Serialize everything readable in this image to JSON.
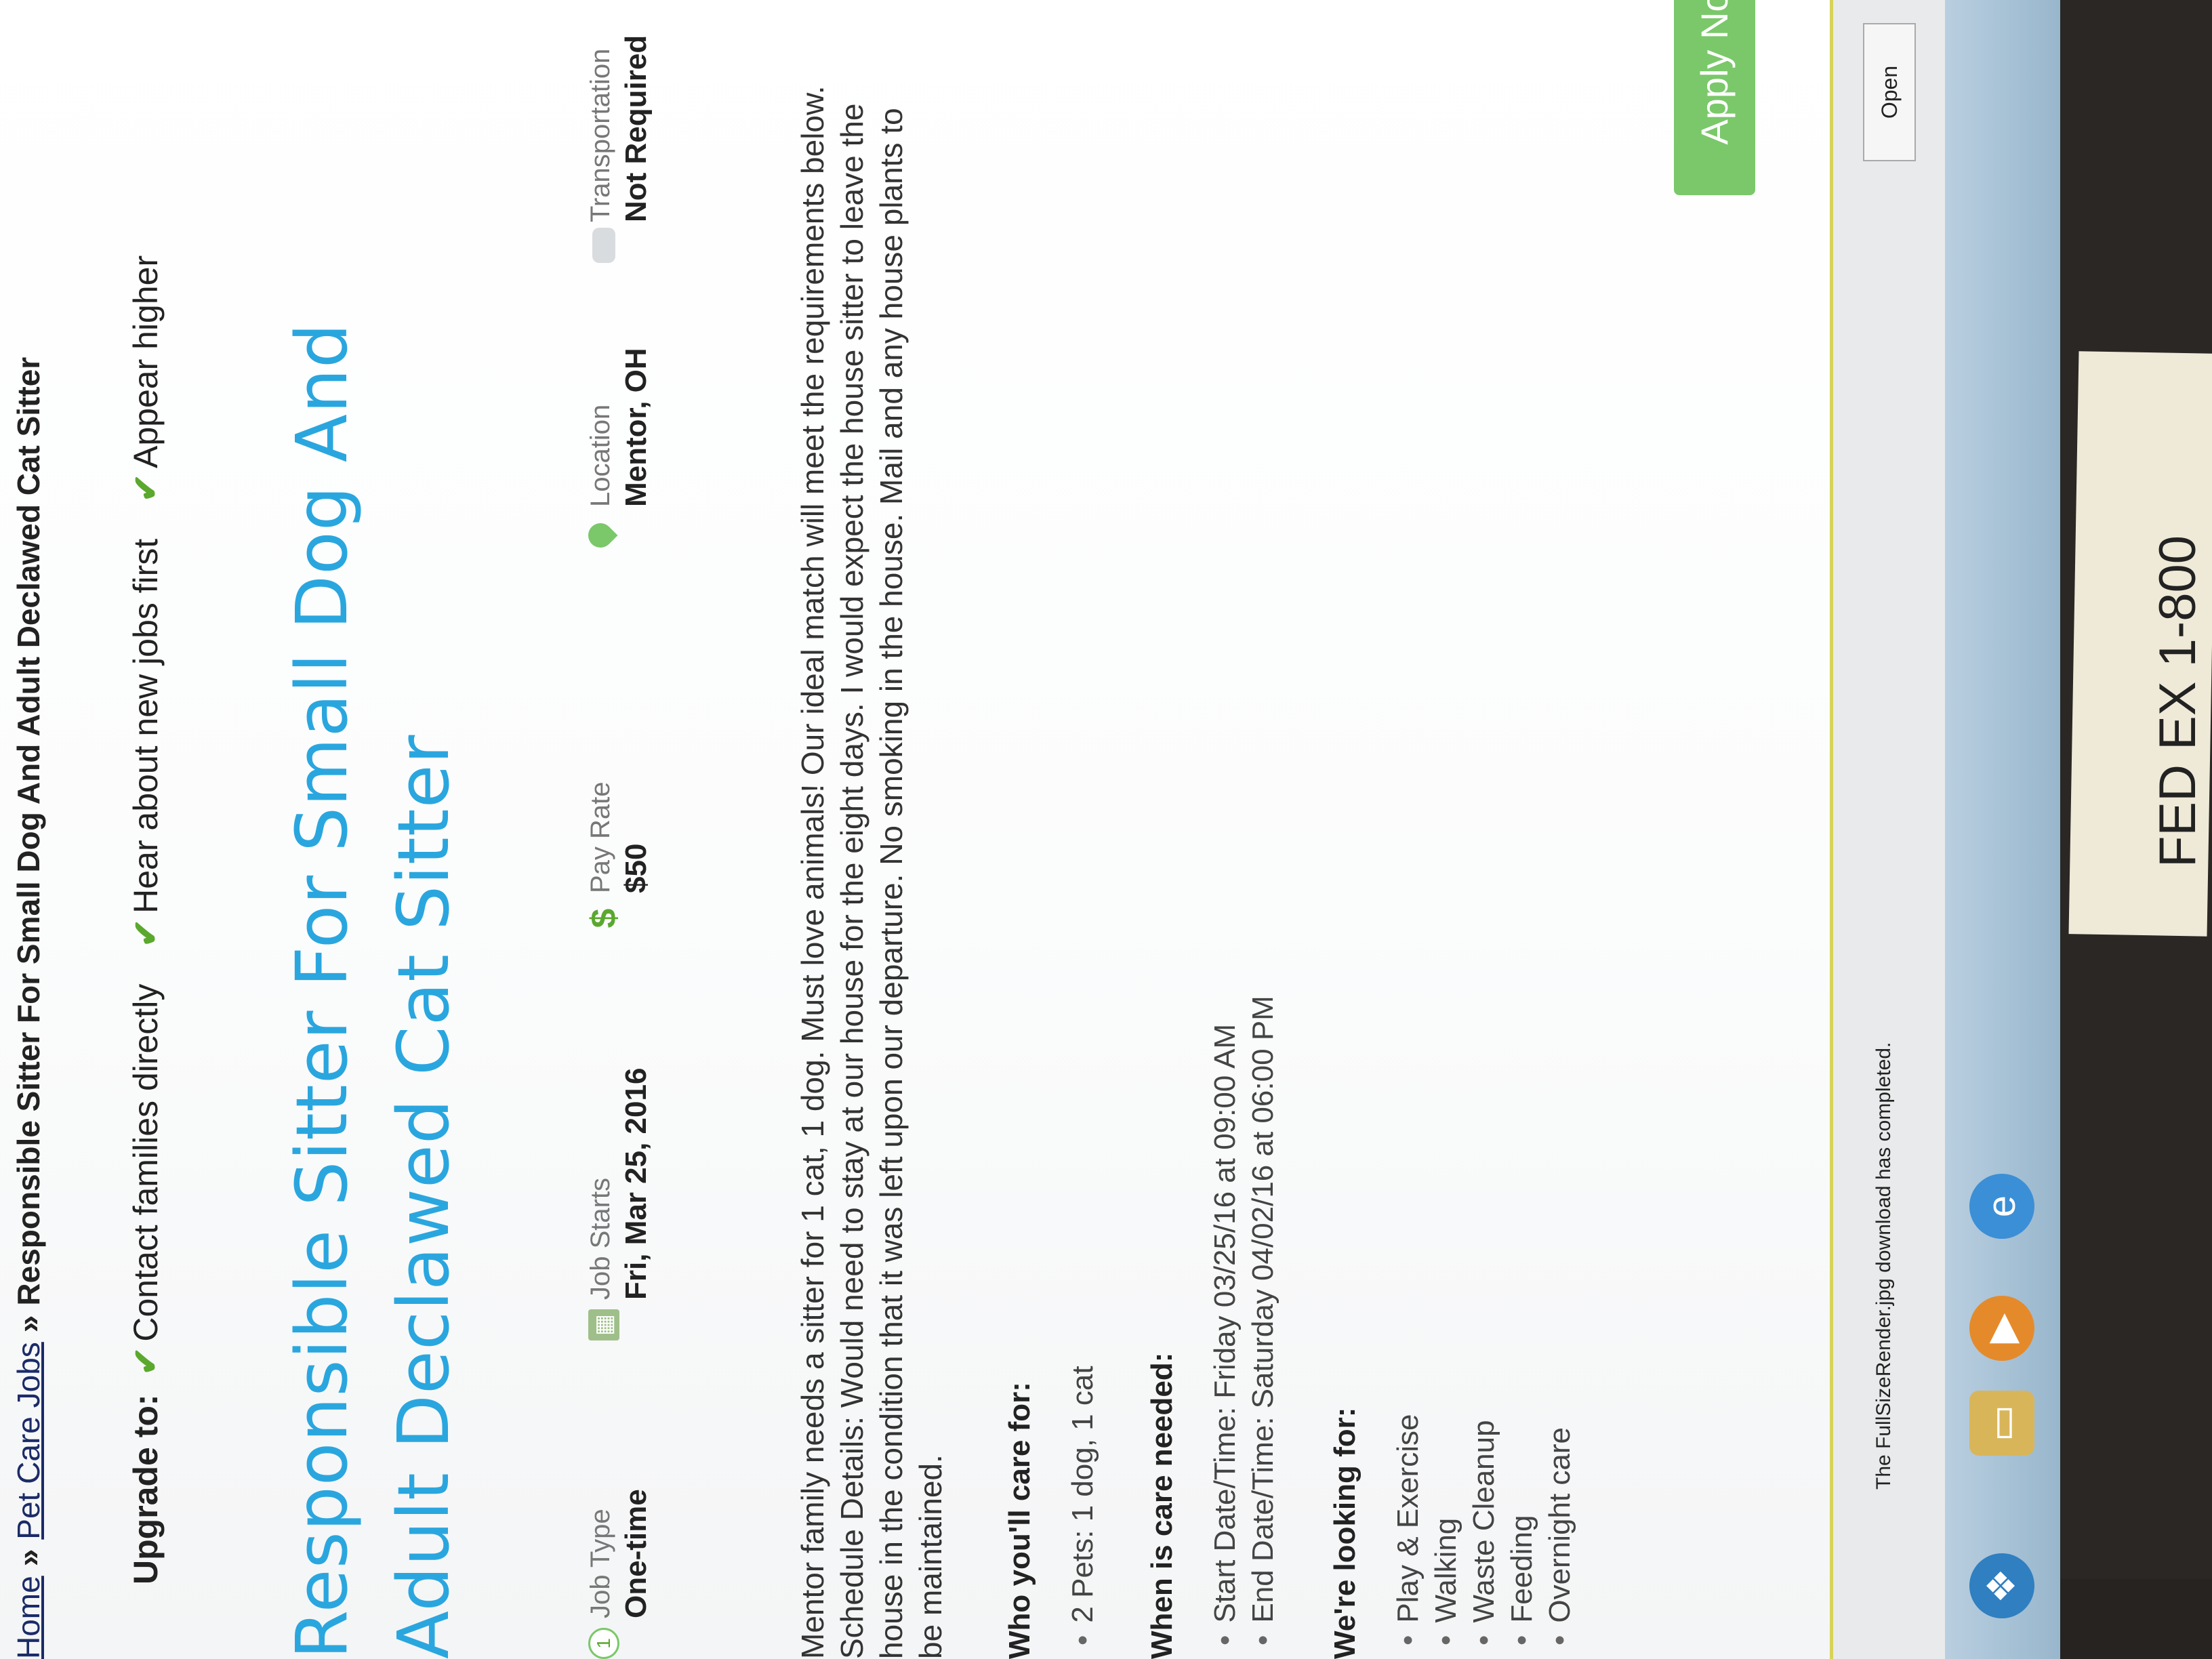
{
  "breadcrumb": {
    "home": "Home",
    "sep": "»",
    "category": "Pet Care Jobs",
    "current": "Responsible Sitter For Small Dog And Adult Declawed Cat Sitter"
  },
  "upgrade": {
    "label": "Upgrade to:",
    "features": [
      "Contact families directly",
      "Hear about new jobs first",
      "Appear higher"
    ]
  },
  "job": {
    "title": "Responsible Sitter For Small Dog And Adult Declawed Cat Sitter",
    "facts": {
      "job_type": {
        "label": "Job Type",
        "value": "One-time"
      },
      "job_starts": {
        "label": "Job Starts",
        "value": "Fri, Mar 25, 2016"
      },
      "pay_rate": {
        "label": "Pay Rate",
        "value": "$50"
      },
      "location": {
        "label": "Location",
        "value": "Mentor, OH"
      },
      "transportation": {
        "label": "Transportation",
        "value": "Not Required"
      }
    },
    "description": "Mentor family needs a sitter for 1 cat, 1 dog. Must love animals! Our ideal match will meet the requirements below. Schedule Details: Would need to stay at our house for the eight days. I would expect the house sitter to leave the house in the condition that it was left upon our departure. No smoking in the house. Mail and any house plants to be maintained.",
    "care_for": {
      "heading": "Who you'll care for:",
      "items": [
        "2 Pets: 1 dog, 1 cat"
      ]
    },
    "when": {
      "heading": "When is care needed:",
      "items": [
        "Start Date/Time: Friday 03/25/16 at 09:00 AM",
        "End Date/Time: Saturday 04/02/16 at 06:00 PM"
      ]
    },
    "looking_for": {
      "heading": "We're looking for:",
      "items": [
        "Play & Exercise",
        "Walking",
        "Waste Cleanup",
        "Feeding",
        "Overnight care"
      ]
    },
    "apply_label": "Apply Now ▸"
  },
  "download_bar": {
    "message": "The FullSizeRender.jpg download has completed.",
    "open_label": "Open"
  },
  "sticky_note": "FED EX 1-800",
  "colors": {
    "title": "#2aa6df",
    "check": "#5aa82e",
    "apply": "#7ac86a",
    "link": "#1b2b68"
  },
  "icons": [
    "check-icon",
    "clock-icon",
    "calendar-icon",
    "dollar-icon",
    "map-pin-icon",
    "car-icon",
    "ie-icon",
    "media-player-icon",
    "folder-icon"
  ]
}
